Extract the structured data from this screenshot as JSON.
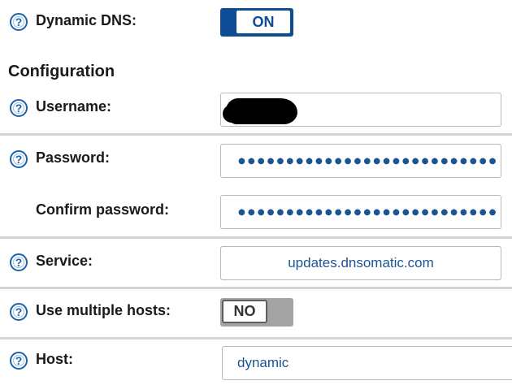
{
  "dynamic_dns": {
    "label": "Dynamic DNS:",
    "toggle": "ON",
    "state": true
  },
  "configuration": {
    "heading": "Configuration"
  },
  "fields": {
    "username": {
      "label": "Username:",
      "value": ""
    },
    "password": {
      "label": "Password:",
      "masked": "●●●●●●●●●●●●●●●●●●●●●●●●●●●"
    },
    "confirm_password": {
      "label": "Confirm password:",
      "masked": "●●●●●●●●●●●●●●●●●●●●●●●●●●●"
    },
    "service": {
      "label": "Service:",
      "value": "updates.dnsomatic.com"
    },
    "multiple_hosts": {
      "label": "Use multiple hosts:",
      "toggle": "NO",
      "state": false
    },
    "host": {
      "label": "Host:",
      "value": "dynamic"
    }
  },
  "colors": {
    "accent": "#0e4c95",
    "text_value": "#1a5494",
    "help_icon": "#1c62a8",
    "divider": "#d4d4d4"
  }
}
